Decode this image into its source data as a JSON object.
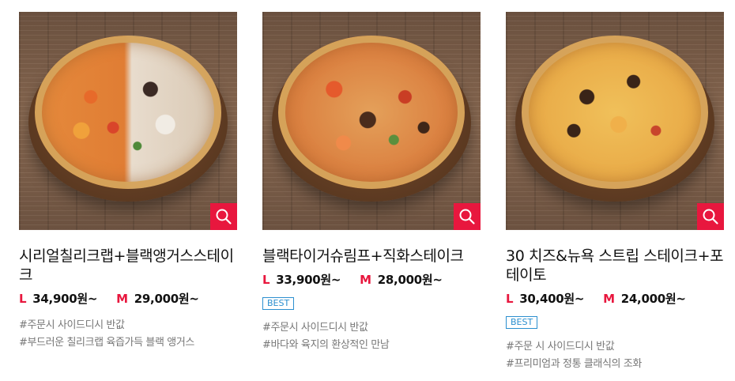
{
  "products": [
    {
      "name": "시리얼칠리크랩+블랙앵거스스테이크",
      "size_l": "L",
      "price_l": "34,900원~",
      "size_m": "M",
      "price_m": "29,000원~",
      "badge": "",
      "tags": [
        "#주문시 사이드디시 반값",
        "#부드러운 칠리크랩 육즙가득 블랙 앵거스"
      ]
    },
    {
      "name": "블랙타이거슈림프+직화스테이크",
      "size_l": "L",
      "price_l": "33,900원~",
      "size_m": "M",
      "price_m": "28,000원~",
      "badge": "BEST",
      "tags": [
        "#주문시 사이드디시 반값",
        "#바다와 육지의 환상적인 만남"
      ]
    },
    {
      "name": "30 치즈&뉴욕 스트립 스테이크+포테이토",
      "size_l": "L",
      "price_l": "30,400원~",
      "size_m": "M",
      "price_m": "24,000원~",
      "badge": "BEST",
      "tags": [
        "#주문 시 사이드디시 반값",
        "#프리미엄과 정통 클래식의 조화"
      ]
    }
  ],
  "icons": {
    "zoom": "magnifier-icon"
  },
  "colors": {
    "accent": "#e8173e",
    "badge": "#2b8fcf"
  }
}
